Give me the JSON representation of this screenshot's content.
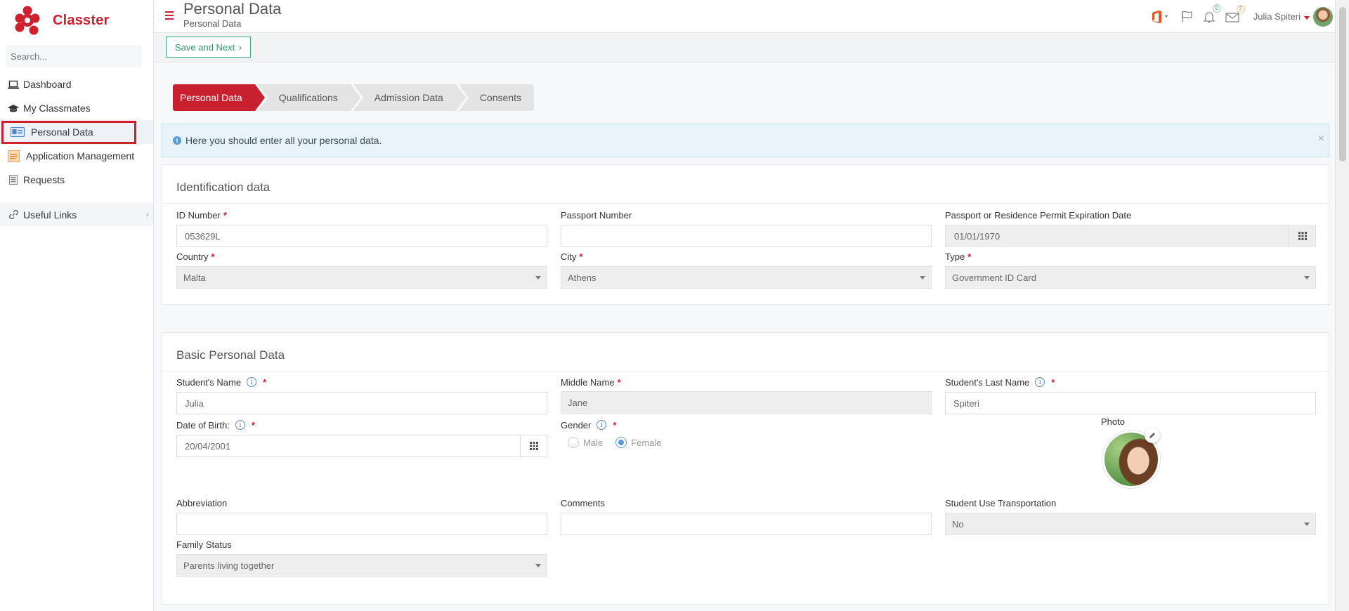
{
  "app": {
    "name": "Classter"
  },
  "sidebar": {
    "search_placeholder": "Search...",
    "items": [
      {
        "label": "Dashboard",
        "icon": "laptop-icon"
      },
      {
        "label": "My Classmates",
        "icon": "graduation-cap-icon"
      },
      {
        "label": "Personal Data",
        "icon": "id-card-icon",
        "active": true
      },
      {
        "label": "Application Management",
        "icon": "document-icon"
      },
      {
        "label": "Requests",
        "icon": "list-icon"
      }
    ],
    "useful_links": "Useful Links"
  },
  "header": {
    "title": "Personal Data",
    "subtitle": "Personal Data",
    "notifications_count": "0",
    "messages_count": "2",
    "user_name": "Julia Spiteri"
  },
  "toolbar": {
    "save_label": "Save and Next"
  },
  "steps": [
    "Personal Data",
    "Qualifications",
    "Admission Data",
    "Consents"
  ],
  "alert": {
    "text": "Here you should enter all your personal data."
  },
  "identification": {
    "title": "Identification data",
    "id_number": {
      "label": "ID Number",
      "value": "053629L"
    },
    "passport": {
      "label": "Passport Number",
      "value": ""
    },
    "expiration": {
      "label": "Passport or Residence Permit Expiration Date",
      "value": "01/01/1970"
    },
    "country": {
      "label": "Country",
      "value": "Malta"
    },
    "city": {
      "label": "City",
      "value": "Athens"
    },
    "type": {
      "label": "Type",
      "value": "Government ID Card"
    }
  },
  "basic": {
    "title": "Basic Personal Data",
    "name": {
      "label": "Student's Name",
      "value": "Julia"
    },
    "middle": {
      "label": "Middle Name",
      "value": "Jane"
    },
    "last": {
      "label": "Student's Last Name",
      "value": "Spiteri"
    },
    "dob": {
      "label": "Date of Birth:",
      "value": "20/04/2001"
    },
    "gender": {
      "label": "Gender",
      "options": [
        "Male",
        "Female"
      ],
      "selected": "Female"
    },
    "photo_label": "Photo",
    "abbreviation": {
      "label": "Abbreviation",
      "value": ""
    },
    "comments": {
      "label": "Comments",
      "value": ""
    },
    "transport": {
      "label": "Student Use Transportation",
      "value": "No"
    },
    "family": {
      "label": "Family Status",
      "value": "Parents living together"
    }
  },
  "colors": {
    "brand": "#d0202e",
    "accent_green": "#2c9a68",
    "info_blue": "#5b9bd5"
  }
}
